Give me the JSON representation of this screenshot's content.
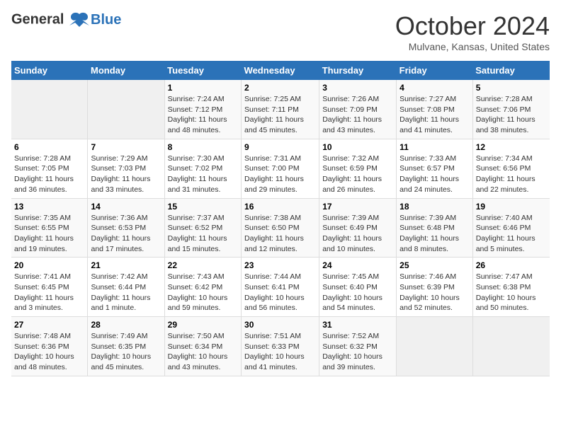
{
  "header": {
    "logo_line1": "General",
    "logo_line2": "Blue",
    "month": "October 2024",
    "location": "Mulvane, Kansas, United States"
  },
  "weekdays": [
    "Sunday",
    "Monday",
    "Tuesday",
    "Wednesday",
    "Thursday",
    "Friday",
    "Saturday"
  ],
  "weeks": [
    [
      {
        "day": "",
        "info": ""
      },
      {
        "day": "",
        "info": ""
      },
      {
        "day": "1",
        "info": "Sunrise: 7:24 AM\nSunset: 7:12 PM\nDaylight: 11 hours and 48 minutes."
      },
      {
        "day": "2",
        "info": "Sunrise: 7:25 AM\nSunset: 7:11 PM\nDaylight: 11 hours and 45 minutes."
      },
      {
        "day": "3",
        "info": "Sunrise: 7:26 AM\nSunset: 7:09 PM\nDaylight: 11 hours and 43 minutes."
      },
      {
        "day": "4",
        "info": "Sunrise: 7:27 AM\nSunset: 7:08 PM\nDaylight: 11 hours and 41 minutes."
      },
      {
        "day": "5",
        "info": "Sunrise: 7:28 AM\nSunset: 7:06 PM\nDaylight: 11 hours and 38 minutes."
      }
    ],
    [
      {
        "day": "6",
        "info": "Sunrise: 7:28 AM\nSunset: 7:05 PM\nDaylight: 11 hours and 36 minutes."
      },
      {
        "day": "7",
        "info": "Sunrise: 7:29 AM\nSunset: 7:03 PM\nDaylight: 11 hours and 33 minutes."
      },
      {
        "day": "8",
        "info": "Sunrise: 7:30 AM\nSunset: 7:02 PM\nDaylight: 11 hours and 31 minutes."
      },
      {
        "day": "9",
        "info": "Sunrise: 7:31 AM\nSunset: 7:00 PM\nDaylight: 11 hours and 29 minutes."
      },
      {
        "day": "10",
        "info": "Sunrise: 7:32 AM\nSunset: 6:59 PM\nDaylight: 11 hours and 26 minutes."
      },
      {
        "day": "11",
        "info": "Sunrise: 7:33 AM\nSunset: 6:57 PM\nDaylight: 11 hours and 24 minutes."
      },
      {
        "day": "12",
        "info": "Sunrise: 7:34 AM\nSunset: 6:56 PM\nDaylight: 11 hours and 22 minutes."
      }
    ],
    [
      {
        "day": "13",
        "info": "Sunrise: 7:35 AM\nSunset: 6:55 PM\nDaylight: 11 hours and 19 minutes."
      },
      {
        "day": "14",
        "info": "Sunrise: 7:36 AM\nSunset: 6:53 PM\nDaylight: 11 hours and 17 minutes."
      },
      {
        "day": "15",
        "info": "Sunrise: 7:37 AM\nSunset: 6:52 PM\nDaylight: 11 hours and 15 minutes."
      },
      {
        "day": "16",
        "info": "Sunrise: 7:38 AM\nSunset: 6:50 PM\nDaylight: 11 hours and 12 minutes."
      },
      {
        "day": "17",
        "info": "Sunrise: 7:39 AM\nSunset: 6:49 PM\nDaylight: 11 hours and 10 minutes."
      },
      {
        "day": "18",
        "info": "Sunrise: 7:39 AM\nSunset: 6:48 PM\nDaylight: 11 hours and 8 minutes."
      },
      {
        "day": "19",
        "info": "Sunrise: 7:40 AM\nSunset: 6:46 PM\nDaylight: 11 hours and 5 minutes."
      }
    ],
    [
      {
        "day": "20",
        "info": "Sunrise: 7:41 AM\nSunset: 6:45 PM\nDaylight: 11 hours and 3 minutes."
      },
      {
        "day": "21",
        "info": "Sunrise: 7:42 AM\nSunset: 6:44 PM\nDaylight: 11 hours and 1 minute."
      },
      {
        "day": "22",
        "info": "Sunrise: 7:43 AM\nSunset: 6:42 PM\nDaylight: 10 hours and 59 minutes."
      },
      {
        "day": "23",
        "info": "Sunrise: 7:44 AM\nSunset: 6:41 PM\nDaylight: 10 hours and 56 minutes."
      },
      {
        "day": "24",
        "info": "Sunrise: 7:45 AM\nSunset: 6:40 PM\nDaylight: 10 hours and 54 minutes."
      },
      {
        "day": "25",
        "info": "Sunrise: 7:46 AM\nSunset: 6:39 PM\nDaylight: 10 hours and 52 minutes."
      },
      {
        "day": "26",
        "info": "Sunrise: 7:47 AM\nSunset: 6:38 PM\nDaylight: 10 hours and 50 minutes."
      }
    ],
    [
      {
        "day": "27",
        "info": "Sunrise: 7:48 AM\nSunset: 6:36 PM\nDaylight: 10 hours and 48 minutes."
      },
      {
        "day": "28",
        "info": "Sunrise: 7:49 AM\nSunset: 6:35 PM\nDaylight: 10 hours and 45 minutes."
      },
      {
        "day": "29",
        "info": "Sunrise: 7:50 AM\nSunset: 6:34 PM\nDaylight: 10 hours and 43 minutes."
      },
      {
        "day": "30",
        "info": "Sunrise: 7:51 AM\nSunset: 6:33 PM\nDaylight: 10 hours and 41 minutes."
      },
      {
        "day": "31",
        "info": "Sunrise: 7:52 AM\nSunset: 6:32 PM\nDaylight: 10 hours and 39 minutes."
      },
      {
        "day": "",
        "info": ""
      },
      {
        "day": "",
        "info": ""
      }
    ]
  ]
}
